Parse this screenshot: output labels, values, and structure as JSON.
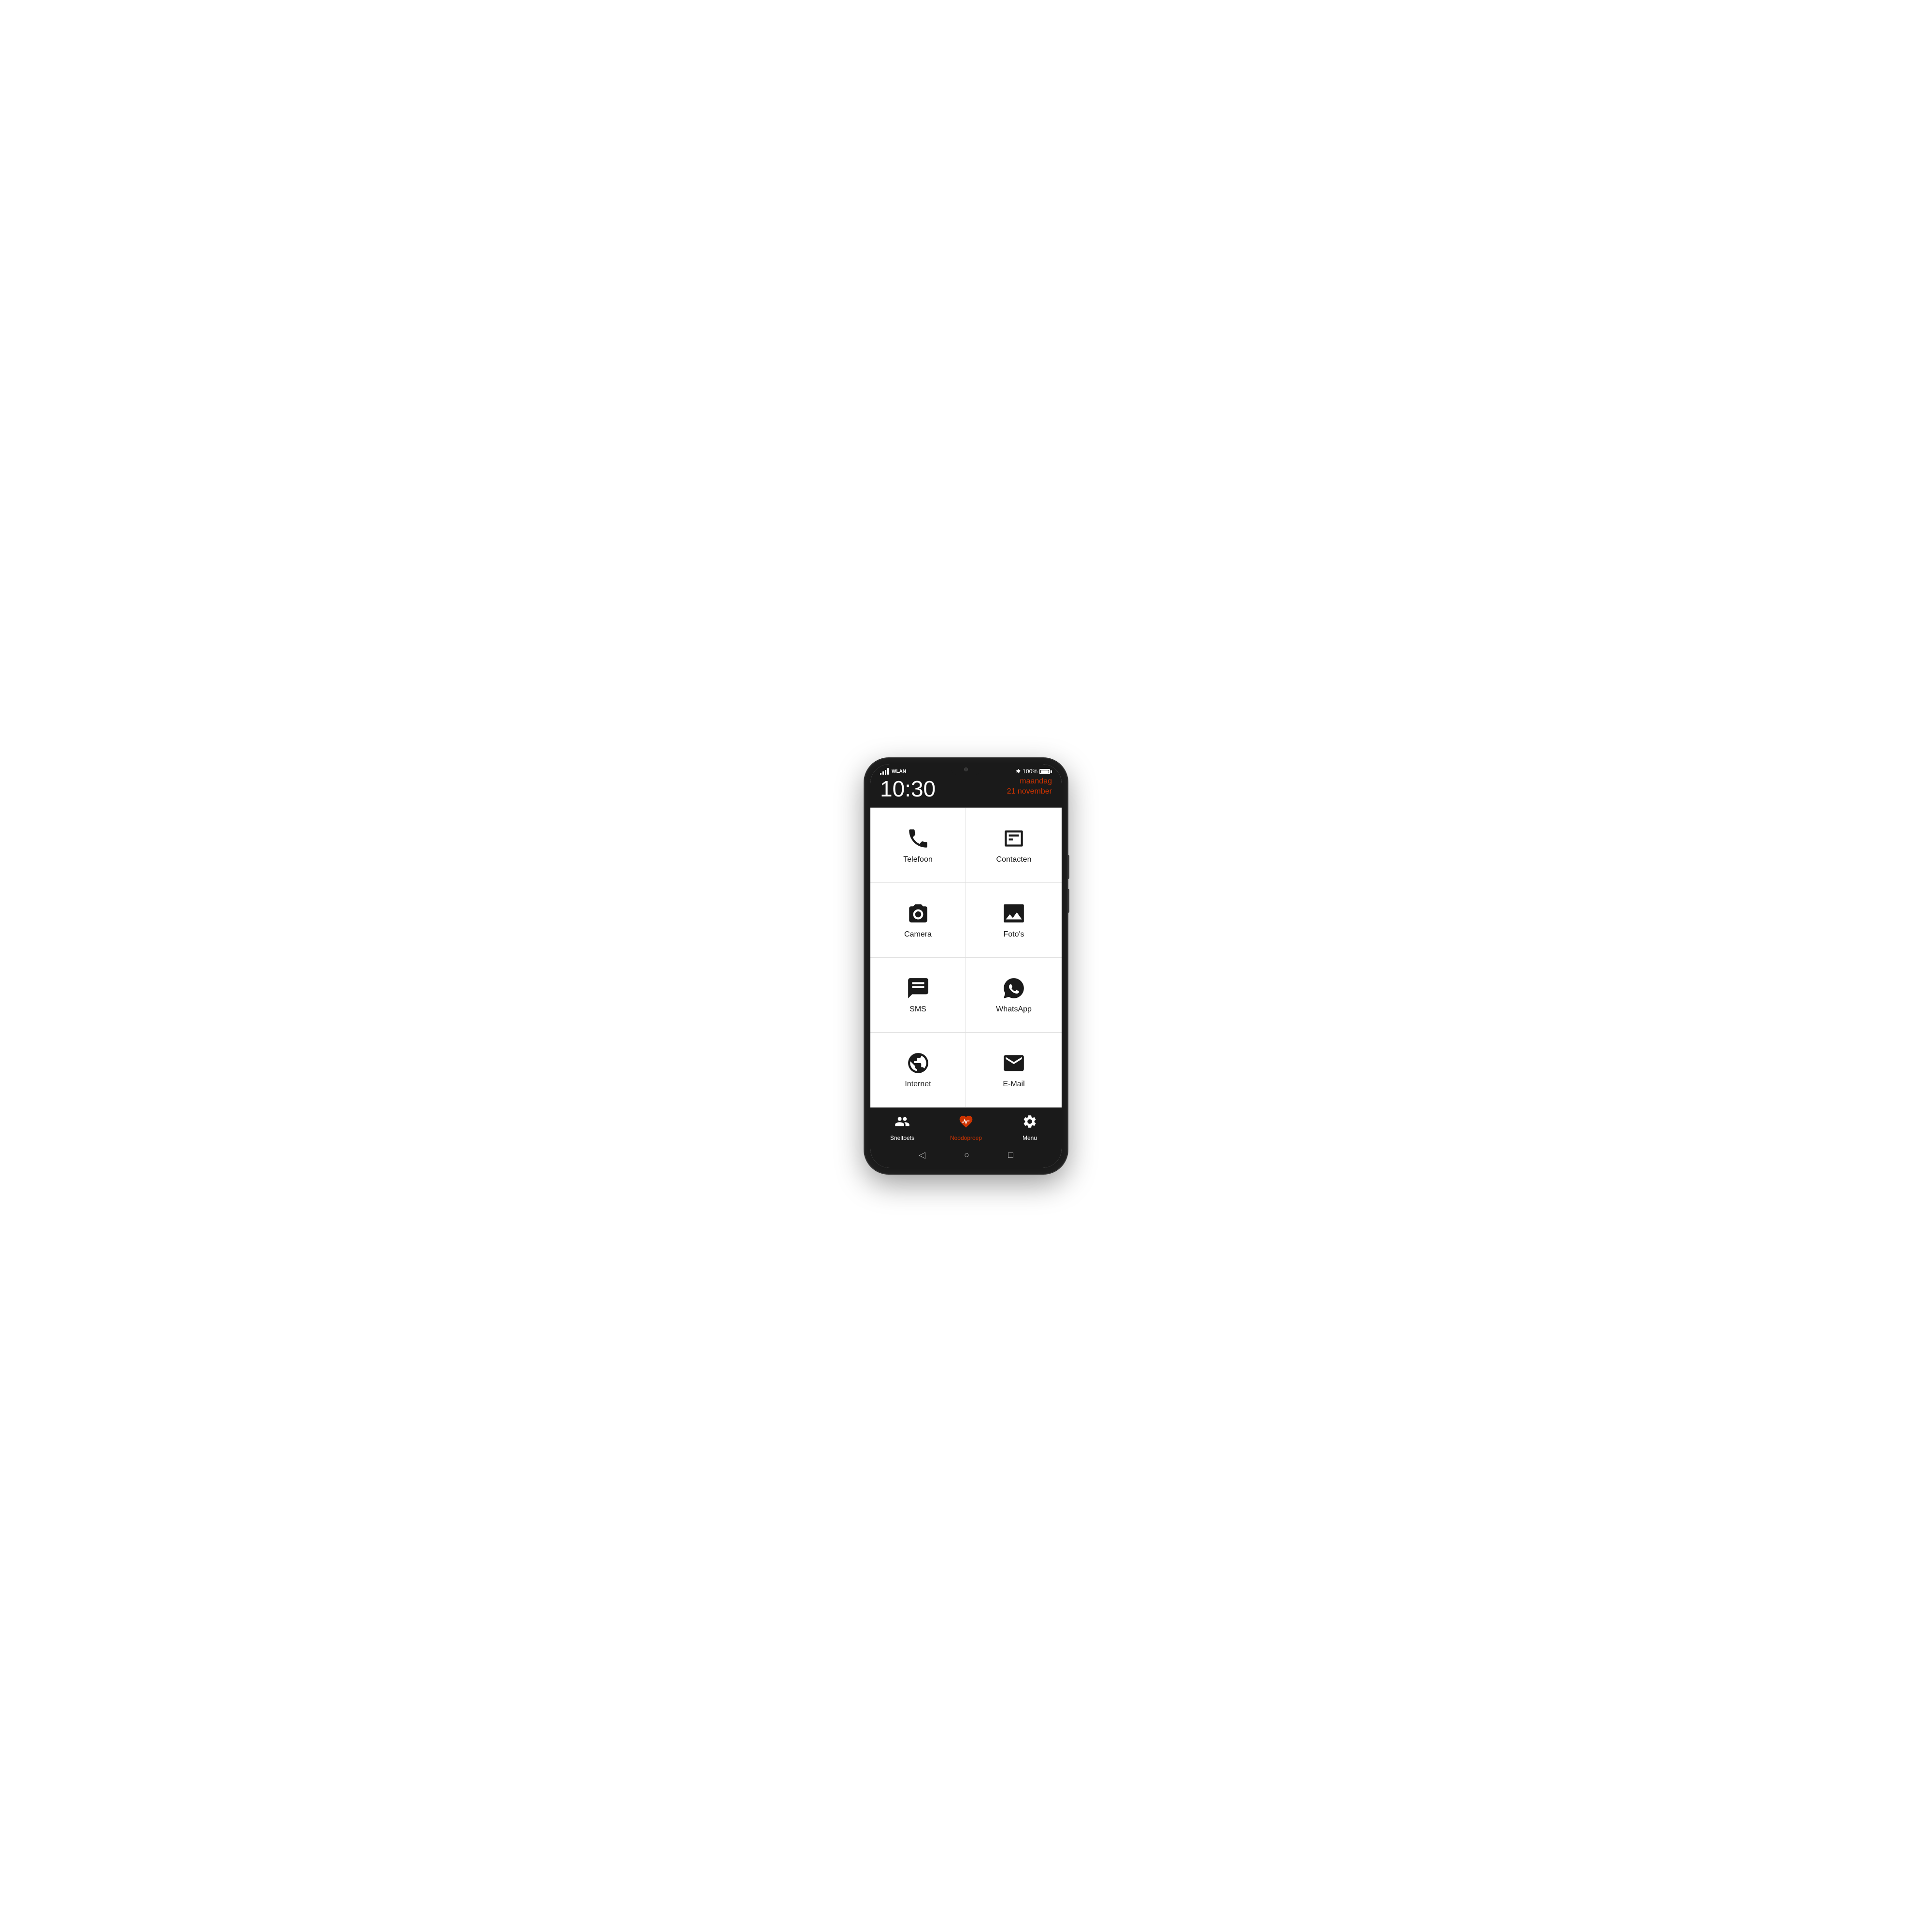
{
  "statusBar": {
    "signal": "signal",
    "wifi": "WLAN",
    "bluetooth": "✱",
    "batteryPercent": "100%",
    "time": "10:30",
    "dayName": "maandag",
    "date": "21 november"
  },
  "apps": [
    {
      "id": "telefoon",
      "label": "Telefoon",
      "icon": "phone"
    },
    {
      "id": "contacten",
      "label": "Contacten",
      "icon": "contacts"
    },
    {
      "id": "camera",
      "label": "Camera",
      "icon": "camera"
    },
    {
      "id": "fotos",
      "label": "Foto's",
      "icon": "photos"
    },
    {
      "id": "sms",
      "label": "SMS",
      "icon": "sms"
    },
    {
      "id": "whatsapp",
      "label": "WhatsApp",
      "icon": "whatsapp"
    },
    {
      "id": "internet",
      "label": "Internet",
      "icon": "internet"
    },
    {
      "id": "email",
      "label": "E-Mail",
      "icon": "email"
    }
  ],
  "navBar": {
    "items": [
      {
        "id": "sneltoets",
        "label": "Sneltoets",
        "icon": "people"
      },
      {
        "id": "noodoproep",
        "label": "Noodoproep",
        "icon": "heart-pulse",
        "accent": true
      },
      {
        "id": "menu",
        "label": "Menu",
        "icon": "gear"
      }
    ]
  },
  "androidBar": {
    "back": "◁",
    "home": "○",
    "recent": "□"
  }
}
